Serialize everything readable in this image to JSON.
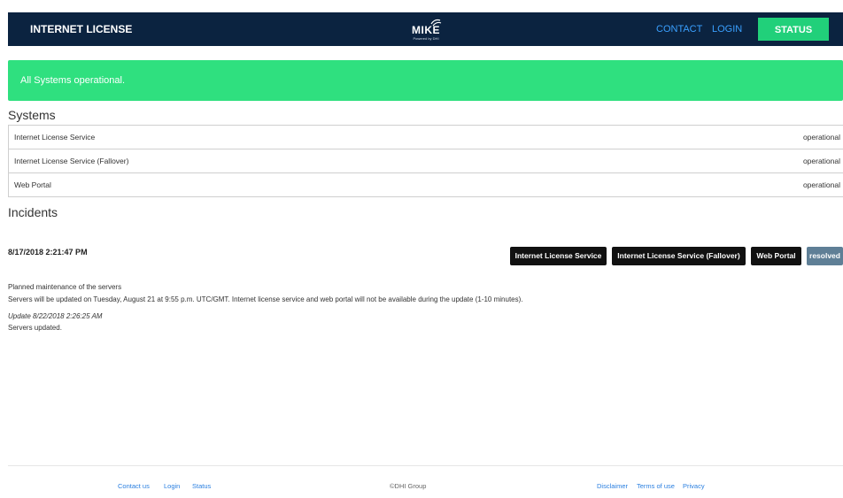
{
  "header": {
    "brand": "INTERNET LICENSE",
    "logo_text": "MIKE",
    "logo_sub": "Powered by DHI",
    "nav": {
      "contact": "CONTACT",
      "login": "LOGIN",
      "status": "STATUS"
    }
  },
  "banner": {
    "text": "All Systems operational.",
    "color": "#2fe07f"
  },
  "systems": {
    "title": "Systems",
    "items": [
      {
        "name": "Internet License Service",
        "status": "operational"
      },
      {
        "name": "Internet License Service (Fallover)",
        "status": "operational"
      },
      {
        "name": "Web Portal",
        "status": "operational"
      }
    ]
  },
  "incidents": {
    "title": "Incidents",
    "items": [
      {
        "date": "8/17/2018 2:21:47 PM",
        "tags": [
          "Internet License Service",
          "Internet License Service (Fallover)",
          "Web Portal"
        ],
        "state": "resolved",
        "title": "Planned maintenance of the servers",
        "description": "Servers will be updated on Tuesday, August 21 at 9:55 p.m. UTC/GMT. Internet license service and web portal will not be available during the update (1-10 minutes).",
        "update_label": "Update 8/22/2018 2:26:25 AM",
        "update_text": "Servers updated."
      }
    ]
  },
  "footer": {
    "links_left": [
      "Contact us",
      "Login",
      "Status"
    ],
    "copyright": "©DHI Group",
    "links_right": [
      "Disclaimer",
      "Terms of use",
      "Privacy"
    ]
  },
  "colors": {
    "navbar": "#0b2340",
    "accent_green": "#21d07a",
    "link_blue": "#3aa0ff",
    "tag_dark": "#111111",
    "tag_resolved": "#5f7f96"
  }
}
